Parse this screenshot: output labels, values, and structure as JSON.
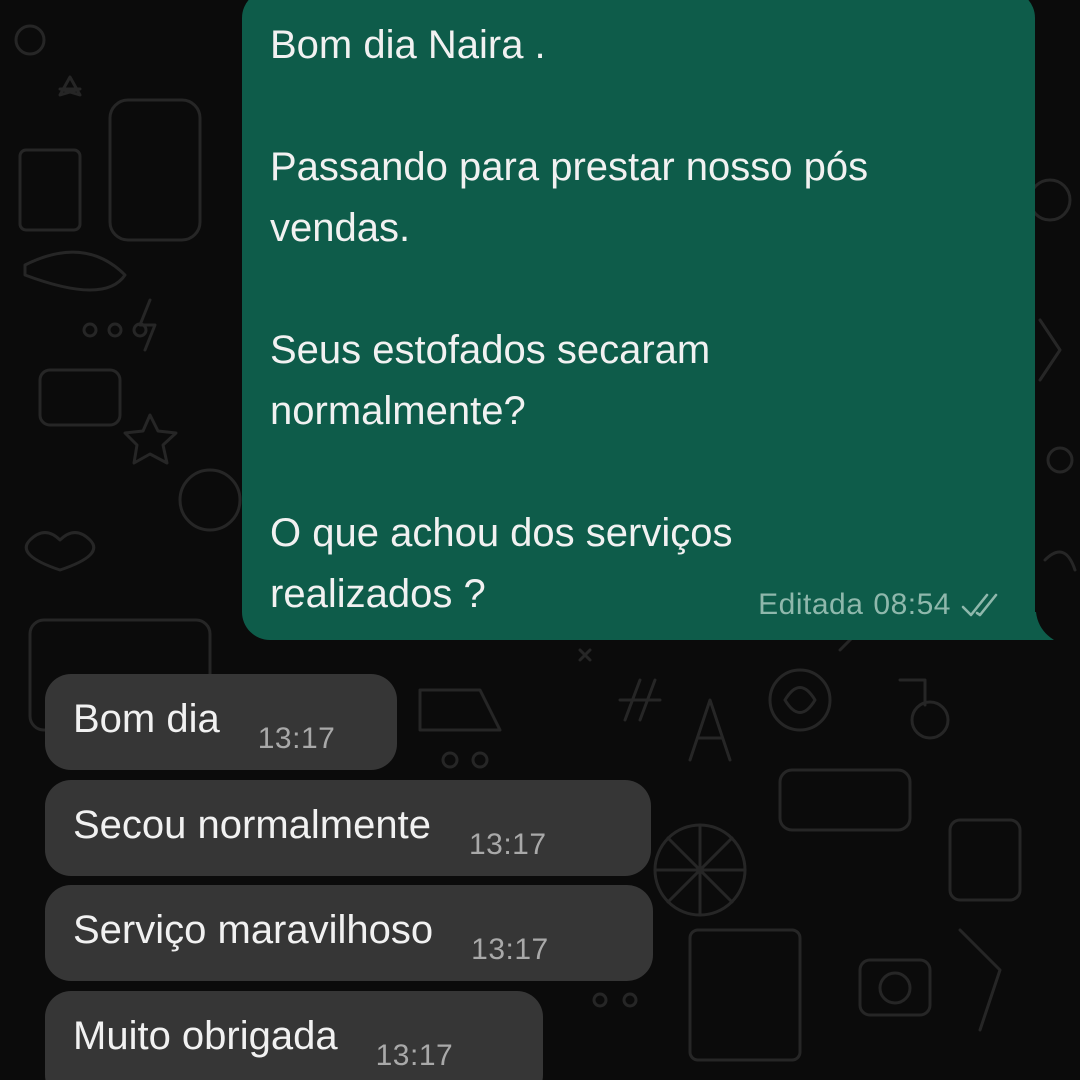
{
  "outgoing": {
    "paragraphs": [
      "Bom dia Naira .",
      "Passando para prestar nosso pós\nvendas.",
      "Seus estofados secaram\nnormalmente?",
      "O que achou dos serviços\nrealizados ?"
    ],
    "edited_label": "Editada",
    "time": "08:54",
    "status_icon": "double-check-icon"
  },
  "incoming": [
    {
      "text": "Bom dia",
      "time": "13:17"
    },
    {
      "text": "Secou normalmente",
      "time": "13:17"
    },
    {
      "text": "Serviço maravilhoso",
      "time": "13:17"
    },
    {
      "text": "Muito obrigada",
      "time": "13:17"
    }
  ],
  "colors": {
    "background": "#0b0b0b",
    "outgoing_bubble": "#0e5c4a",
    "incoming_bubble": "#363636",
    "doodle": "#2a2a2a"
  }
}
